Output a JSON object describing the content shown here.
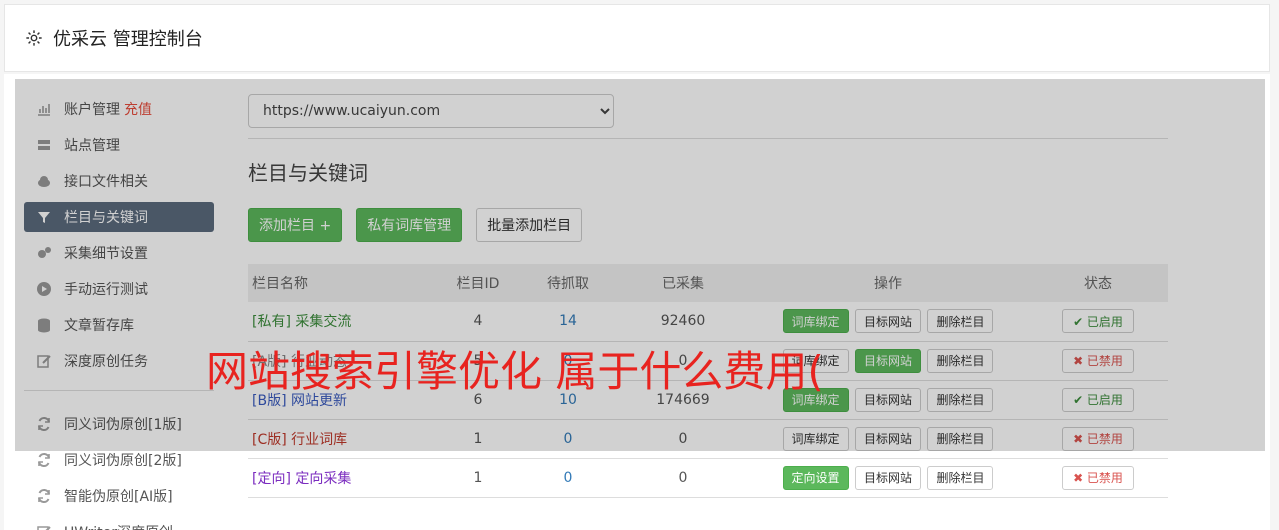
{
  "header": {
    "title": "优采云 管理控制台"
  },
  "sidebar": {
    "items": [
      {
        "label": "账户管理",
        "extra": "充值",
        "icon": "bar-chart-icon"
      },
      {
        "label": "站点管理",
        "icon": "server-icon"
      },
      {
        "label": "接口文件相关",
        "icon": "cloud-upload-icon"
      },
      {
        "label": "栏目与关键词",
        "icon": "filter-icon",
        "active": true
      },
      {
        "label": "采集细节设置",
        "icon": "gears-icon"
      },
      {
        "label": "手动运行测试",
        "icon": "play-circle-icon"
      },
      {
        "label": "文章暂存库",
        "icon": "database-icon"
      },
      {
        "label": "深度原创任务",
        "icon": "edit-icon"
      }
    ],
    "items2": [
      {
        "label": "同义词伪原创[1版]",
        "icon": "refresh-icon"
      },
      {
        "label": "同义词伪原创[2版]",
        "icon": "refresh-icon"
      },
      {
        "label": "智能伪原创[AI版]",
        "icon": "refresh-icon"
      },
      {
        "label": "UWriter深度原创",
        "icon": "edit-icon"
      }
    ]
  },
  "main": {
    "site_select": "https://www.ucaiyun.com",
    "section_title": "栏目与关键词",
    "buttons": {
      "add": "添加栏目 +",
      "private": "私有词库管理",
      "batch": "批量添加栏目"
    },
    "table": {
      "headers": [
        "栏目名称",
        "栏目ID",
        "待抓取",
        "已采集",
        "操作",
        "状态"
      ],
      "rows": [
        {
          "tag": "[私有]",
          "name": "采集交流",
          "id": "4",
          "pending": "14",
          "collected": "92460",
          "op1": "词库绑定",
          "op2": "目标网站",
          "op3": "删除栏目",
          "status": "✔ 已启用"
        },
        {
          "tag": "[A版]",
          "name": "行业动态",
          "id": "5",
          "pending": "0",
          "collected": "0",
          "op1": "词库绑定",
          "op2": "目标网站",
          "op3": "删除栏目",
          "status": "✖ 已禁用"
        },
        {
          "tag": "[B版]",
          "name": "网站更新",
          "id": "6",
          "pending": "10",
          "collected": "174669",
          "op1": "词库绑定",
          "op2": "目标网站",
          "op3": "删除栏目",
          "status": "✔ 已启用"
        },
        {
          "tag": "[C版]",
          "name": "行业词库",
          "id": "1",
          "pending": "0",
          "collected": "0",
          "op1": "词库绑定",
          "op2": "目标网站",
          "op3": "删除栏目",
          "status": "✖ 已禁用"
        },
        {
          "tag": "[定向]",
          "name": "定向采集",
          "id": "1",
          "pending": "0",
          "collected": "0",
          "op1": "定向设置",
          "op2": "目标网站",
          "op3": "删除栏目",
          "status": "✖ 已禁用"
        }
      ]
    }
  },
  "watermark": "网站搜索引擎优化 属于什么费用(",
  "colors": {
    "accent_green": "#5cb85c",
    "active_nav": "#5b6b7d",
    "danger": "#d9534f",
    "watermark": "#e8231f"
  }
}
